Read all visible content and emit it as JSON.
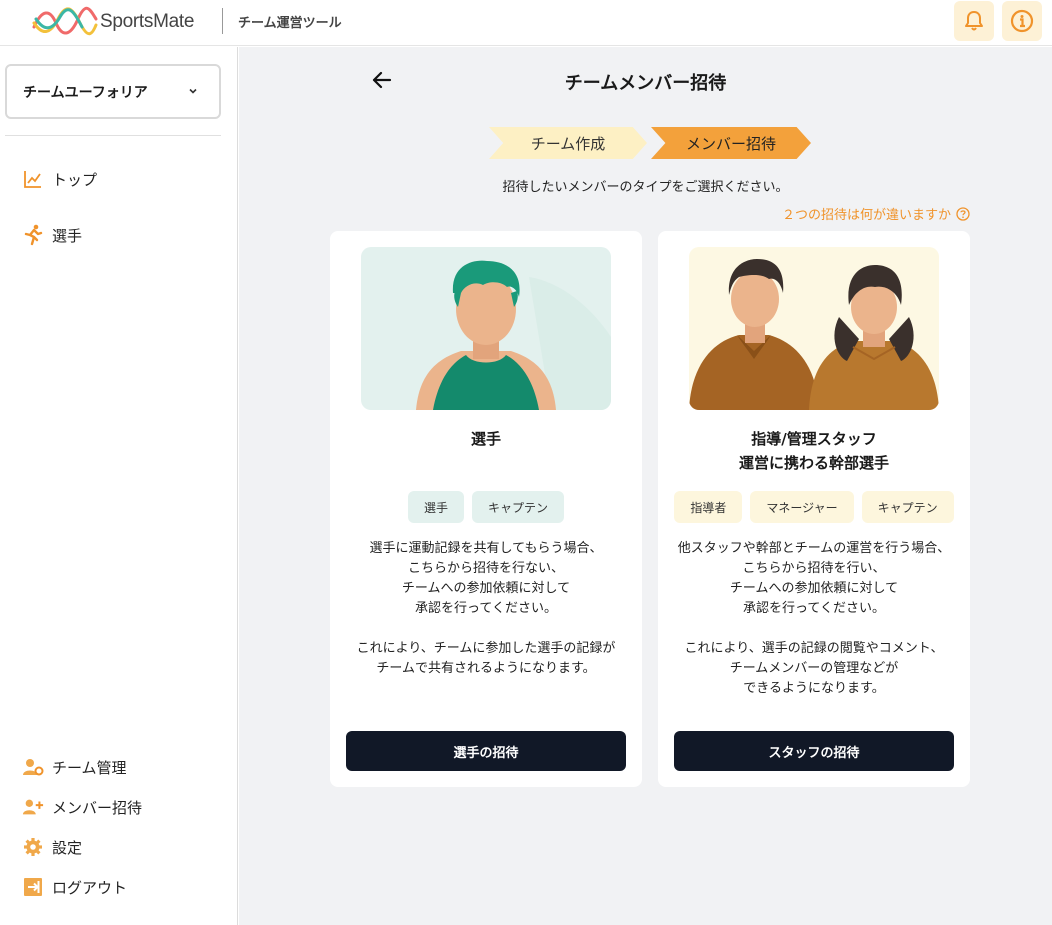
{
  "header": {
    "logo_text": "SportsMate",
    "subtitle": "チーム運営ツール",
    "icons": [
      "bell-icon",
      "info-icon"
    ]
  },
  "sidebar": {
    "team_select": "チームユーフォリア",
    "top_items": [
      {
        "label": "トップ",
        "icon": "chart-line-icon"
      },
      {
        "label": "選手",
        "icon": "runner-icon"
      }
    ],
    "bottom_items": [
      {
        "label": "チーム管理",
        "icon": "user-gear-icon"
      },
      {
        "label": "メンバー招待",
        "icon": "user-plus-icon"
      },
      {
        "label": "設定",
        "icon": "gear-icon"
      },
      {
        "label": "ログアウト",
        "icon": "logout-icon"
      }
    ]
  },
  "main": {
    "title": "チームメンバー招待",
    "steps": [
      "チーム作成",
      "メンバー招待"
    ],
    "instruction": "招待したいメンバーのタイプをご選択ください。",
    "diff_link": "２つの招待は何が違いますか",
    "cards": [
      {
        "title": "選手",
        "tags": [
          "選手",
          "キャプテン"
        ],
        "description": "選手に運動記録を共有してもらう場合、\nこちらから招待を行ない、\nチームへの参加依頼に対して\n承認を行ってください。\n\nこれにより、チームに参加した選手の記録が\nチームで共有されるようになります。",
        "button": "選手の招待"
      },
      {
        "title_line1": "指導/管理スタッフ",
        "title_line2": "運営に携わる幹部選手",
        "tags": [
          "指導者",
          "マネージャー",
          "キャプテン"
        ],
        "description": "他スタッフや幹部とチームの運営を行う場合、\nこちらから招待を行い、\nチームへの参加依頼に対して\n承認を行ってください。\n\nこれにより、選手の記録の閲覧やコメント、\nチームメンバーの管理などが\nできるようになります。",
        "button": "スタッフの招待"
      }
    ]
  },
  "colors": {
    "accent": "#f3a13b",
    "step_inactive": "#fdf0c4",
    "button_dark": "#111827",
    "main_bg": "#f1f2f4"
  }
}
